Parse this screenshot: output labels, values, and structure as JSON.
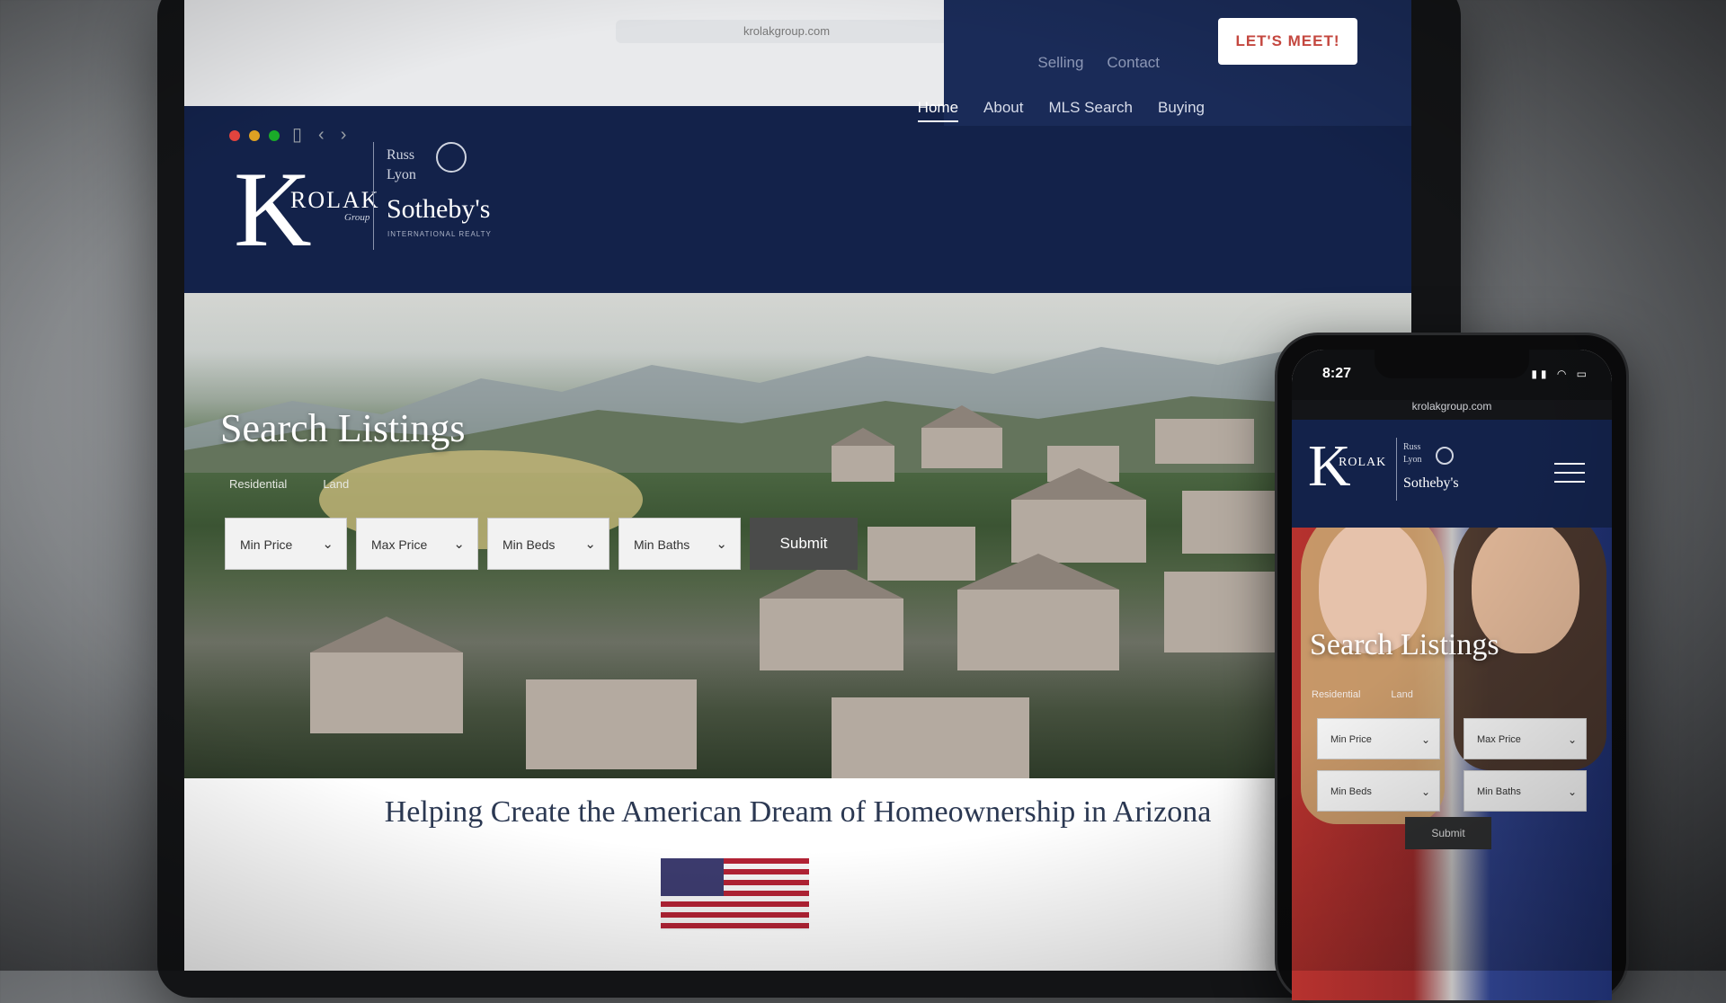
{
  "desktop": {
    "url": "krolakgroup.com",
    "nav": {
      "items": [
        "Home",
        "About",
        "MLS Search",
        "Buying",
        "Selling",
        "Contact"
      ],
      "cta": "LET'S MEET!"
    },
    "logo": {
      "k": "K",
      "rolak": "ROLAK",
      "group": "Group",
      "russ": "Russ",
      "lyon": "Lyon",
      "sothebys": "Sotheby's",
      "sub": "INTERNATIONAL REALTY"
    },
    "hero": {
      "title": "Search Listings",
      "tabs": [
        "Residential",
        "Land"
      ],
      "filters": [
        "Min Price",
        "Max Price",
        "Min Beds",
        "Min Baths"
      ],
      "submit": "Submit"
    },
    "tagline": "Helping Create the American Dream of Homeownership in Arizona"
  },
  "phone": {
    "time": "8:27",
    "url": "krolakgroup.com",
    "logo": {
      "k": "K",
      "rolak": "ROLAK",
      "russ": "Russ",
      "lyon": "Lyon",
      "sothebys": "Sotheby's"
    },
    "hero": {
      "title": "Search Listings",
      "tabs": [
        "Residential",
        "Land"
      ],
      "filters": [
        "Min Price",
        "Max Price",
        "Min Beds",
        "Min Baths"
      ],
      "submit": "Submit"
    }
  },
  "colors": {
    "navy": "#13224a",
    "cta_red": "#c4473f"
  }
}
